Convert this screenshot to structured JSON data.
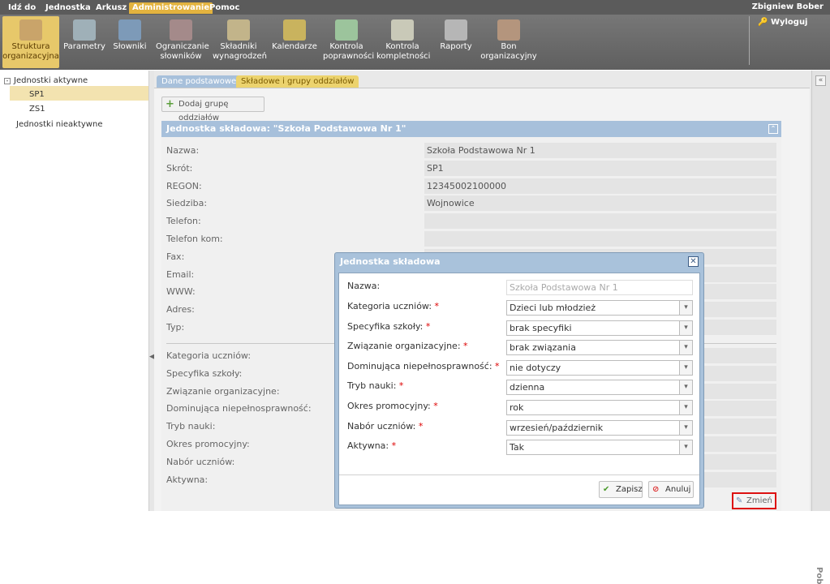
{
  "menu": {
    "items": [
      "Idź do",
      "Jednostka",
      "Arkusz",
      "Administrowanie",
      "Pomoc"
    ],
    "user": "Zbigniew Bober"
  },
  "toolbar": {
    "items": [
      {
        "label": "Struktura organizacyjna"
      },
      {
        "label": "Parametry"
      },
      {
        "label": "Słowniki"
      },
      {
        "label": "Ograniczanie słowników"
      },
      {
        "label": "Składniki wynagrodzeń"
      },
      {
        "label": "Kalendarze"
      },
      {
        "label": "Kontrola poprawności"
      },
      {
        "label": "Kontrola kompletności"
      },
      {
        "label": "Raporty"
      },
      {
        "label": "Bon organizacyjny"
      }
    ],
    "logout": "Wyloguj"
  },
  "tree": {
    "active": "Jednostki aktywne",
    "sp1": "SP1",
    "zs1": "ZS1",
    "inactive": "Jednostki nieaktywne"
  },
  "tabs": [
    "Dane podstawowe",
    "Składowe i grupy oddziałów"
  ],
  "add_group": "Dodaj grupę oddziałów",
  "panel": {
    "title": "Jednostka składowa: \"Szkoła Podstawowa Nr 1\"",
    "fields": [
      {
        "label": "Nazwa:",
        "value": "Szkoła Podstawowa Nr 1"
      },
      {
        "label": "Skrót:",
        "value": "SP1"
      },
      {
        "label": "REGON:",
        "value": "12345002100000"
      },
      {
        "label": "Siedziba:",
        "value": "Wojnowice"
      },
      {
        "label": "Telefon:",
        "value": ""
      },
      {
        "label": "Telefon kom:",
        "value": ""
      },
      {
        "label": "Fax:"
      },
      {
        "label": "Email:"
      },
      {
        "label": "WWW:"
      },
      {
        "label": "Adres:"
      },
      {
        "label": "Typ:"
      }
    ],
    "fields2": [
      "Kategoria uczniów:",
      "Specyfika szkoły:",
      "Związanie organizacyjne:",
      "Dominująca niepełnosprawność:",
      "Tryb nauki:",
      "Okres promocyjny:",
      "Nabór uczniów:",
      "Aktywna:"
    ],
    "change": "Zmień"
  },
  "rightbar": "Pob",
  "modal": {
    "title": "Jednostka składowa",
    "name_label": "Nazwa:",
    "name_value": "Szkoła Podstawowa Nr 1",
    "rows": [
      {
        "label": "Kategoria uczniów:",
        "value": "Dzieci lub młodzież"
      },
      {
        "label": "Specyfika szkoły:",
        "value": "brak specyfiki"
      },
      {
        "label": "Związanie organizacyjne:",
        "value": "brak związania"
      },
      {
        "label": "Dominująca niepełnosprawność:",
        "value": "nie dotyczy"
      },
      {
        "label": "Tryb nauki:",
        "value": "dzienna"
      },
      {
        "label": "Okres promocyjny:",
        "value": "rok"
      },
      {
        "label": "Nabór uczniów:",
        "value": "wrzesień/październik"
      },
      {
        "label": "Aktywna:",
        "value": "Tak"
      }
    ],
    "save": "Zapisz",
    "cancel": "Anuluj"
  }
}
